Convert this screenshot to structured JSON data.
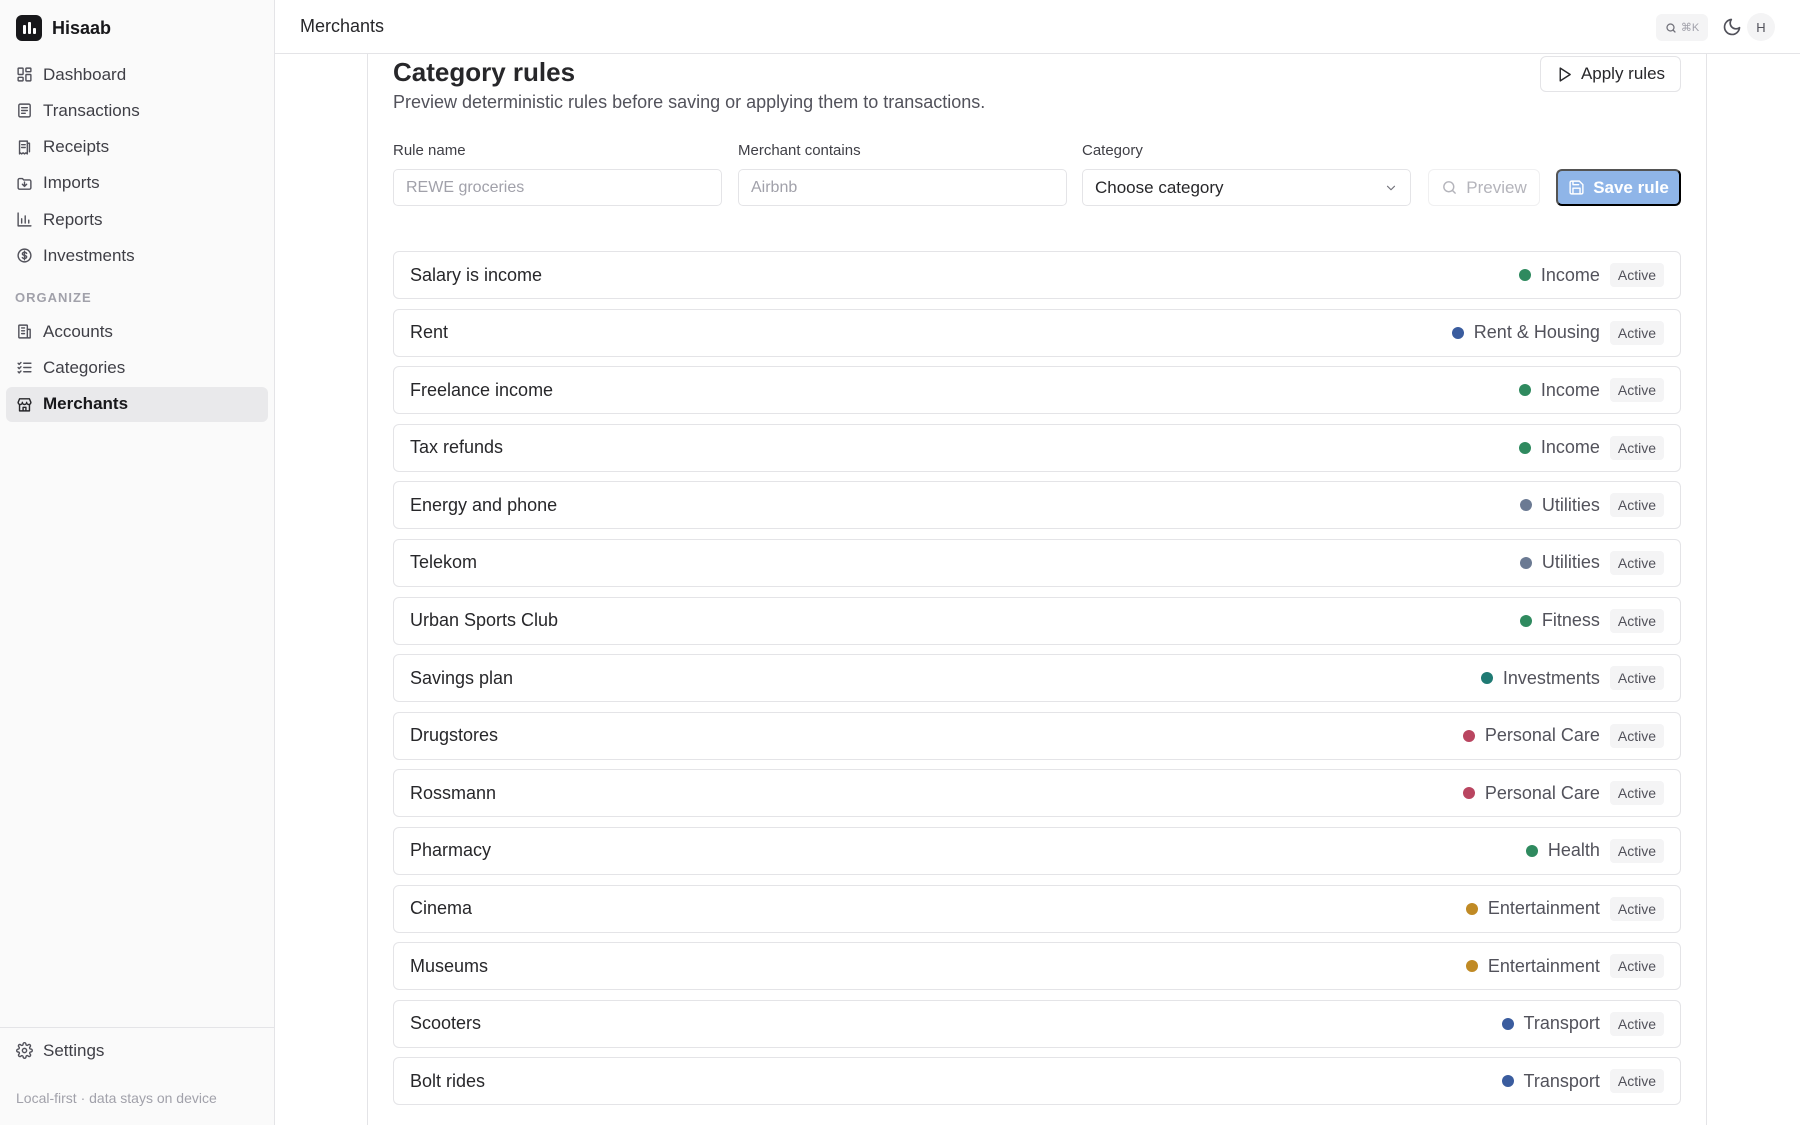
{
  "app": {
    "name": "Hisaab"
  },
  "nav": {
    "main": [
      {
        "label": "Dashboard",
        "icon": "dashboard-icon"
      },
      {
        "label": "Transactions",
        "icon": "transactions-icon"
      },
      {
        "label": "Receipts",
        "icon": "receipt-icon"
      },
      {
        "label": "Imports",
        "icon": "import-icon"
      },
      {
        "label": "Reports",
        "icon": "bar-chart-icon"
      },
      {
        "label": "Investments",
        "icon": "dollar-circle-icon"
      }
    ],
    "section_label": "ORGANIZE",
    "organize": [
      {
        "label": "Accounts",
        "icon": "building-icon"
      },
      {
        "label": "Categories",
        "icon": "list-check-icon"
      },
      {
        "label": "Merchants",
        "icon": "store-icon",
        "active": true
      }
    ],
    "settings_label": "Settings",
    "footer_note": "Local-first · data stays on device"
  },
  "topbar": {
    "title": "Merchants",
    "search_shortcut": "⌘K",
    "avatar_initial": "H"
  },
  "rules_section": {
    "title": "Category rules",
    "subtitle": "Preview deterministic rules before saving or applying them to transactions.",
    "apply_label": "Apply rules",
    "form": {
      "rule_name_label": "Rule name",
      "rule_name_placeholder": "REWE groceries",
      "merchant_label": "Merchant contains",
      "merchant_placeholder": "Airbnb",
      "category_label": "Category",
      "category_value": "Choose category",
      "preview_label": "Preview",
      "save_label": "Save rule"
    },
    "rules": [
      {
        "name": "Salary is income",
        "category": "Income",
        "color": "#2f8a5f",
        "status": "Active"
      },
      {
        "name": "Rent",
        "category": "Rent & Housing",
        "color": "#3a5c9e",
        "status": "Active"
      },
      {
        "name": "Freelance income",
        "category": "Income",
        "color": "#2f8a5f",
        "status": "Active"
      },
      {
        "name": "Tax refunds",
        "category": "Income",
        "color": "#2f8a5f",
        "status": "Active"
      },
      {
        "name": "Energy and phone",
        "category": "Utilities",
        "color": "#6b7a93",
        "status": "Active"
      },
      {
        "name": "Telekom",
        "category": "Utilities",
        "color": "#6b7a93",
        "status": "Active"
      },
      {
        "name": "Urban Sports Club",
        "category": "Fitness",
        "color": "#2f8a5f",
        "status": "Active"
      },
      {
        "name": "Savings plan",
        "category": "Investments",
        "color": "#1f7a73",
        "status": "Active"
      },
      {
        "name": "Drugstores",
        "category": "Personal Care",
        "color": "#b94560",
        "status": "Active"
      },
      {
        "name": "Rossmann",
        "category": "Personal Care",
        "color": "#b94560",
        "status": "Active"
      },
      {
        "name": "Pharmacy",
        "category": "Health",
        "color": "#2f8a5f",
        "status": "Active"
      },
      {
        "name": "Cinema",
        "category": "Entertainment",
        "color": "#c08a25",
        "status": "Active"
      },
      {
        "name": "Museums",
        "category": "Entertainment",
        "color": "#c08a25",
        "status": "Active"
      },
      {
        "name": "Scooters",
        "category": "Transport",
        "color": "#3a5c9e",
        "status": "Active"
      },
      {
        "name": "Bolt rides",
        "category": "Transport",
        "color": "#3a5c9e",
        "status": "Active"
      }
    ]
  }
}
